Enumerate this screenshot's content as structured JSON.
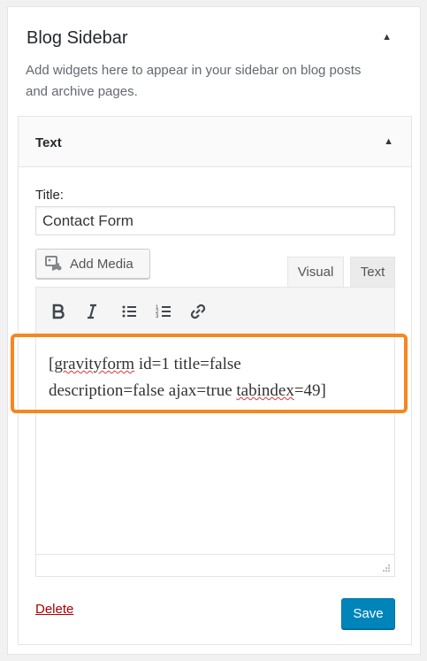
{
  "sidebar_panel": {
    "title": "Blog Sidebar",
    "toggle_icon": "triangle-up-icon",
    "description": "Add widgets here to appear in your sidebar on blog posts and archive pages."
  },
  "widget": {
    "title": "Text",
    "toggle_icon": "triangle-up-icon",
    "title_label": "Title:",
    "title_value": "Contact Form",
    "add_media_label": "Add Media",
    "tabs": {
      "visual": "Visual",
      "text": "Text"
    },
    "toolbar": [
      "bold-icon",
      "italic-icon",
      "bulleted-list-icon",
      "numbered-list-icon",
      "link-icon"
    ],
    "content": {
      "line1_a": "[",
      "line1_b": "gravityform",
      "line1_c": " id=1 title=false",
      "line2_a": "description=false ajax=true ",
      "line2_b": "tabindex",
      "line2_c": "=49]"
    },
    "delete_label": "Delete",
    "save_label": "Save"
  },
  "colors": {
    "highlight": "#f6861f",
    "save_button": "#0085ba",
    "delete_link": "#aa0000"
  }
}
